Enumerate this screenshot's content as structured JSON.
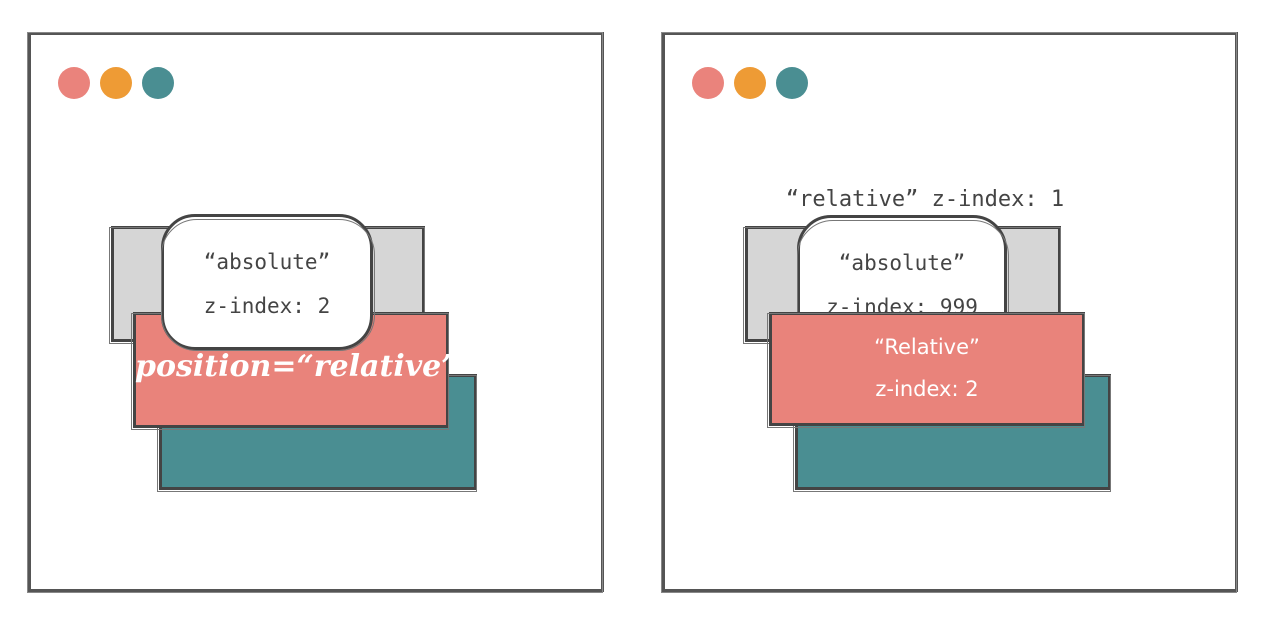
{
  "window_left": {
    "dots": [
      "#ea837c",
      "#ee9b35",
      "#4a8e92"
    ],
    "bubble": {
      "line1": "“absolute”",
      "line2": "z-index: 2"
    },
    "middle_label": "position=“relative”"
  },
  "window_right": {
    "dots": [
      "#ea837c",
      "#ee9b35",
      "#4a8e92"
    ],
    "top_label": "“relative” z-index: 1",
    "bubble": {
      "line1": "“absolute”",
      "line2": "z-index: 999"
    },
    "middle": {
      "line1": "“Relative”",
      "line2": "z-index: 2"
    }
  },
  "colors": {
    "grey": "#d6d6d6",
    "coral": "#e9837b",
    "teal": "#4a8e92",
    "border": "#444444"
  }
}
